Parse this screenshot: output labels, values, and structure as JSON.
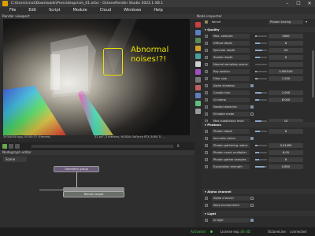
{
  "window": {
    "title": "C:\\Users\\cnut\\Downloads\\Prescidexprism_01.orbx - OctaneRender Studio 2022.1 XB.1",
    "minimize": "–",
    "maximize": "☐",
    "close": "✕"
  },
  "menu": [
    "File",
    "Edit",
    "Script",
    "Module",
    "Cloud",
    "Windows",
    "Help"
  ],
  "viewport": {
    "title": "Render viewport",
    "annotation": "Abnormal noises!?!",
    "status_line_1": "393/4000 spp, 00:00:37 (Frames)",
    "status_line_2": "32 px², 3 meshes, NVIDIA GeForce RTX 3080 Ti ..."
  },
  "timeline": {
    "frame": "0"
  },
  "node_editor": {
    "title": "Nodegraph editor",
    "scene_tab": "Scene",
    "nodes": {
      "geometry": "Geometry group",
      "render_target": "Render target"
    }
  },
  "inspector": {
    "title": "Node inspector",
    "kernel_label": "Kernel",
    "kernel_value": "Photon tracing",
    "sections": {
      "quality": "Quality",
      "photons": "Photons",
      "alpha": "Alpha channel",
      "light": "Light"
    },
    "quality_rows": [
      {
        "label": "Max. samples",
        "value": "4000",
        "fill": 0.1
      },
      {
        "label": "Diffuse depth",
        "value": "8",
        "fill": 0.4
      },
      {
        "label": "Specular depth",
        "value": "24",
        "fill": 0.6
      },
      {
        "label": "Scatter depth",
        "value": "8",
        "fill": 0.4
      },
      {
        "label": "Normal sampling source",
        "value": "",
        "fill": 0
      },
      {
        "label": "Ray epsilon",
        "value": "0.000100",
        "fill": 0.1
      },
      {
        "label": "Filter size",
        "value": "1.200",
        "fill": 0.2
      },
      {
        "label": "Alpha shadows",
        "value": "",
        "fill": 0,
        "check": true
      },
      {
        "label": "Caustic blur",
        "value": "1.000",
        "fill": 0.5
      },
      {
        "label": "GI clamp",
        "value": "8.040",
        "fill": 0.3
      },
      {
        "label": "Nested dielectric",
        "value": "",
        "fill": 0,
        "check": true
      },
      {
        "label": "Emulate mode",
        "value": "",
        "fill": 0,
        "check": false
      },
      {
        "label": "Max subdivision level",
        "value": "10",
        "fill": 0.5
      }
    ],
    "photon_rows": [
      {
        "label": "Photon depth",
        "value": "8",
        "fill": 0.4
      },
      {
        "label": "Accurate colors",
        "value": "",
        "fill": 0,
        "check": true
      },
      {
        "label": "Photon gathering radius",
        "value": "0.01490",
        "fill": 0.2
      },
      {
        "label": "Photon count multiplier",
        "value": "8.00",
        "fill": 0.3
      },
      {
        "label": "Photon gather samples",
        "value": "8",
        "fill": 0.3
      },
      {
        "label": "Exploration strength",
        "value": "0.800",
        "fill": 0.8
      }
    ],
    "alpha_rows": [
      {
        "label": "Alpha channel",
        "value": "",
        "check": false
      },
      {
        "label": "Keep environment",
        "value": "",
        "check": false
      }
    ],
    "light_rows": [
      {
        "label": "AI light",
        "value": "",
        "check": true
      }
    ]
  },
  "statusbar": {
    "activated": "Activated",
    "license": "License exp.:",
    "hours": "4h 4D",
    "live": "OctaneLive:",
    "connected": "connected"
  },
  "colors": {
    "accent_yellow": "#e8e100",
    "activated_green": "#4cc24c",
    "panel": "#2c2c2c"
  }
}
